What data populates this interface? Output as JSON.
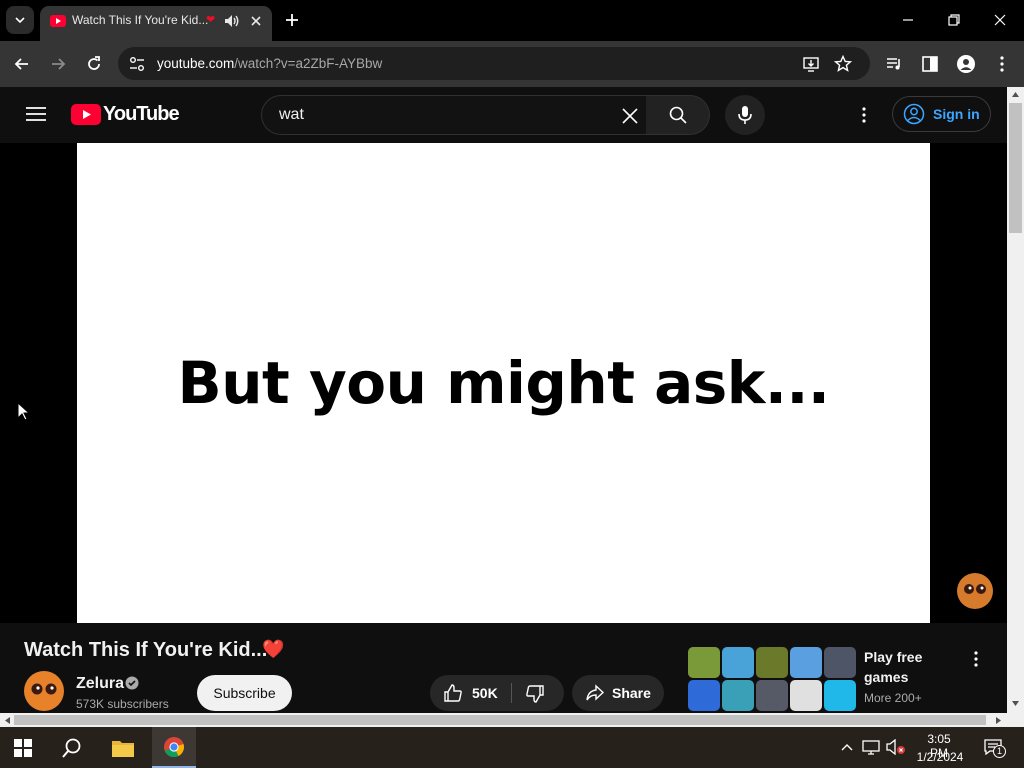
{
  "browser": {
    "tab": {
      "title": "Watch This If You're Kid...",
      "heart": "❤"
    },
    "address": {
      "host": "youtube.com",
      "path": "/watch?v=a2ZbF-AYBbw"
    }
  },
  "youtube": {
    "logo_text": "YouTube",
    "search": {
      "value": "wat"
    },
    "signin_label": "Sign in",
    "video": {
      "caption": "But you might ask...",
      "title": "Watch This If You're Kid...",
      "title_emoji": "❤️"
    },
    "channel": {
      "name": "Zelura",
      "subscribers": "573K subscribers",
      "subscribe_label": "Subscribe"
    },
    "actions": {
      "likes": "50K",
      "share_label": "Share"
    },
    "promo": {
      "title": "Play free games",
      "subtitle": "More 200+"
    },
    "accent_colors": {
      "brand_red": "#ff0033",
      "link_blue": "#3ea6ff"
    }
  },
  "taskbar": {
    "time": "3:05 PM",
    "date": "1/2/2024",
    "notification_count": "1"
  }
}
